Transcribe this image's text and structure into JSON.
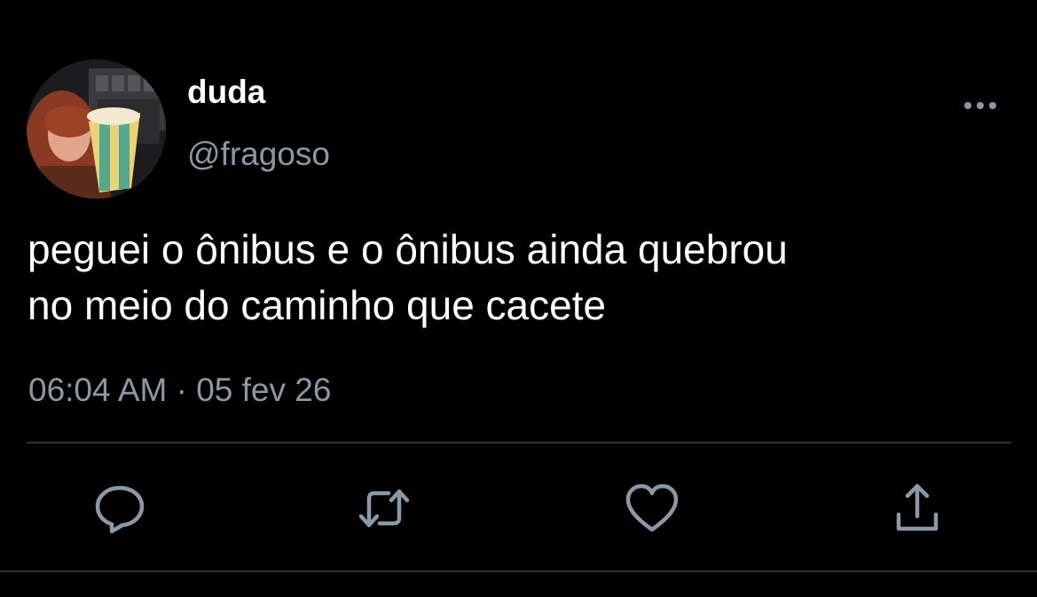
{
  "tweet": {
    "display_name": "duda",
    "handle": "@fragoso",
    "text": "peguei o ônibus e o ônibus ainda quebrou\nno meio do caminho que cacete",
    "timestamp": "06:04 AM · 05 fev 26"
  },
  "icons": {
    "more": "more-horizontal-icon",
    "reply": "reply-icon",
    "retweet": "retweet-icon",
    "like": "heart-icon",
    "share": "share-icon"
  },
  "colors": {
    "background": "#000000",
    "primary_text": "#ffffff",
    "secondary_text": "#8b98a5",
    "divider": "#2f3336",
    "icon": "#8b98a5"
  }
}
